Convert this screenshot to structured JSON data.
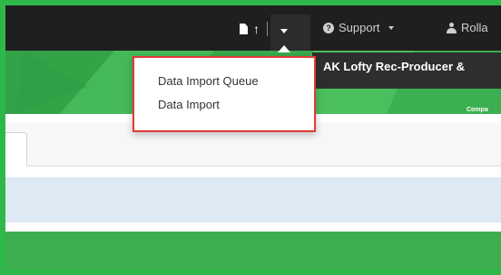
{
  "colors": {
    "frame_green": "#2eb84a",
    "navbar": "#1f1f1f",
    "banner_green": "#3cae4f",
    "highlight_red": "#e53935",
    "info_row": "#dde9f3"
  },
  "navbar": {
    "icons": [
      "document-icon",
      "upload-arrow-icon",
      "caret-down-icon"
    ],
    "support_label": "Support",
    "user_label": "Rolla"
  },
  "dropdown": {
    "items": [
      {
        "label": "Data Import Queue"
      },
      {
        "label": "Data Import"
      }
    ]
  },
  "company_tooltip": {
    "label": "AK Lofty Rec-Producer &"
  },
  "banner": {
    "company_text": "Compa"
  }
}
